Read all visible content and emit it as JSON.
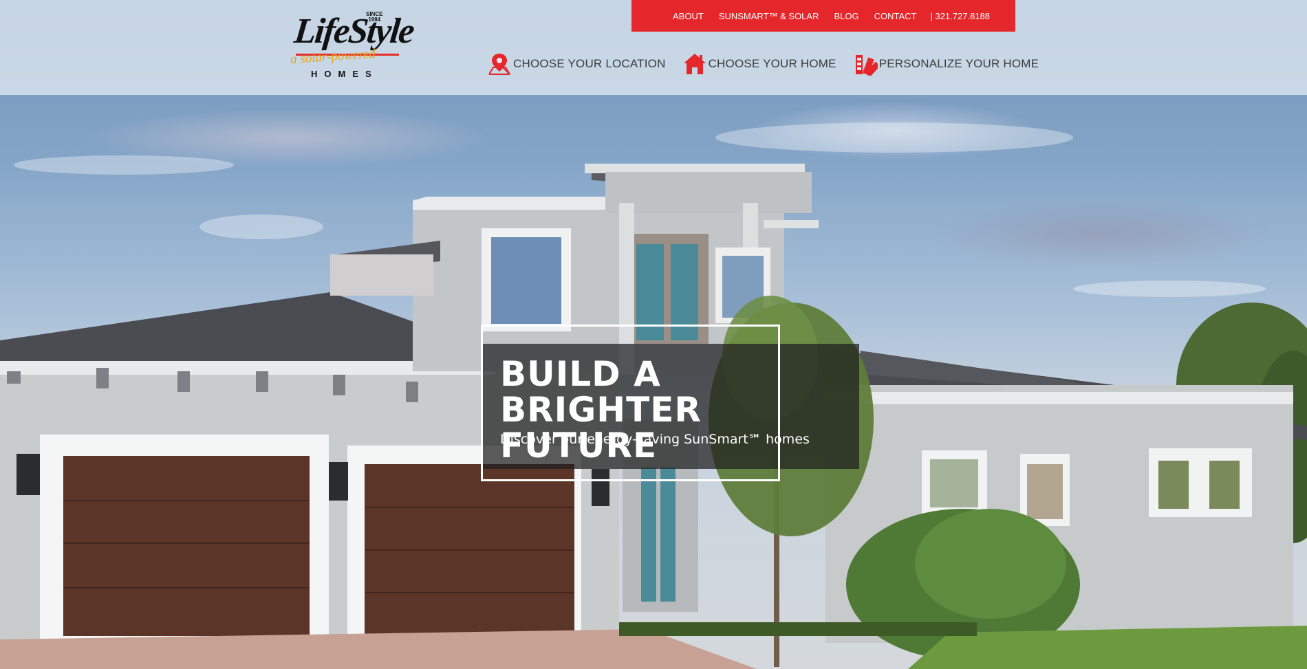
{
  "brand": {
    "since_line1": "SINCE",
    "since_line2": "1984",
    "wordmark": "LifeStyle",
    "tagline": "a solar-powered",
    "homes": "HOMES"
  },
  "topbar": {
    "links": [
      "ABOUT",
      "SUNSMART™ & SOLAR",
      "BLOG",
      "CONTACT"
    ],
    "phone": "| 321.727.8188",
    "color": "#e5262a"
  },
  "mainnav": {
    "items": [
      {
        "label": "CHOOSE YOUR LOCATION",
        "icon": "map-pin-icon"
      },
      {
        "label": "CHOOSE YOUR HOME",
        "icon": "house-icon"
      },
      {
        "label": "PERSONALIZE YOUR HOME",
        "icon": "color-swatch-icon"
      }
    ],
    "icon_color": "#e5262a"
  },
  "hero": {
    "title": "BUILD A BRIGHTER FUTURE",
    "subtitle": "Discover our energy-saving SunSmart℠ homes",
    "image": "two-story gray house with brown garage doors under a blue sky"
  }
}
